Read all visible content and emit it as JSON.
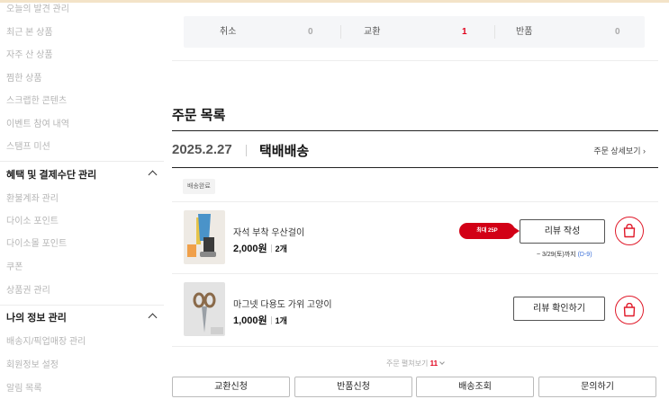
{
  "sidebar": {
    "items_top": [
      "오늘의 발견 관리",
      "최근 본 상품",
      "자주 산 상품",
      "찜한 상품",
      "스크랩한 콘텐츠",
      "이벤트 참여 내역",
      "스탬프 미션"
    ],
    "section_benefits": {
      "title": "혜택 및 결제수단 관리",
      "items": [
        "환불계좌 관리",
        "다이소 포인트",
        "다이소몰 포인트",
        "쿠폰",
        "상품권 관리"
      ]
    },
    "section_myinfo": {
      "title": "나의 정보 관리",
      "items": [
        "배송지/픽업매장 관리",
        "회원정보 설정",
        "알림 목록"
      ]
    }
  },
  "stats": [
    {
      "label": "취소",
      "value": "0"
    },
    {
      "label": "교환",
      "value": "1"
    },
    {
      "label": "반품",
      "value": "0"
    }
  ],
  "section_title": "주문 목록",
  "order": {
    "date": "2025.2.27",
    "type": "택배배송",
    "detail_link": "주문 상세보기 ›",
    "status_badge": "배송완료",
    "items": [
      {
        "name": "자석 부착 우산걸이",
        "price": "2,000원",
        "qty": "2개",
        "point_badge": "최대 25P",
        "button": "리뷰 작성",
        "deadline": "~ 3/29(토)까지",
        "dday": "(D-9)"
      },
      {
        "name": "마그넷 다용도 가위 고양이",
        "price": "1,000원",
        "qty": "1개",
        "button": "리뷰 확인하기"
      }
    ],
    "fold": {
      "label": "주문 펼쳐보기",
      "count": "11"
    },
    "actions": [
      "교환신청",
      "반품신청",
      "배송조회",
      "문의하기"
    ]
  },
  "colors": {
    "accent_red": "#e0001b",
    "dday_blue": "#3b6fd8"
  },
  "icons": {
    "cart": "shopping-bag-icon",
    "collapse": "chevron-up-icon",
    "expand": "chevron-down-icon"
  }
}
